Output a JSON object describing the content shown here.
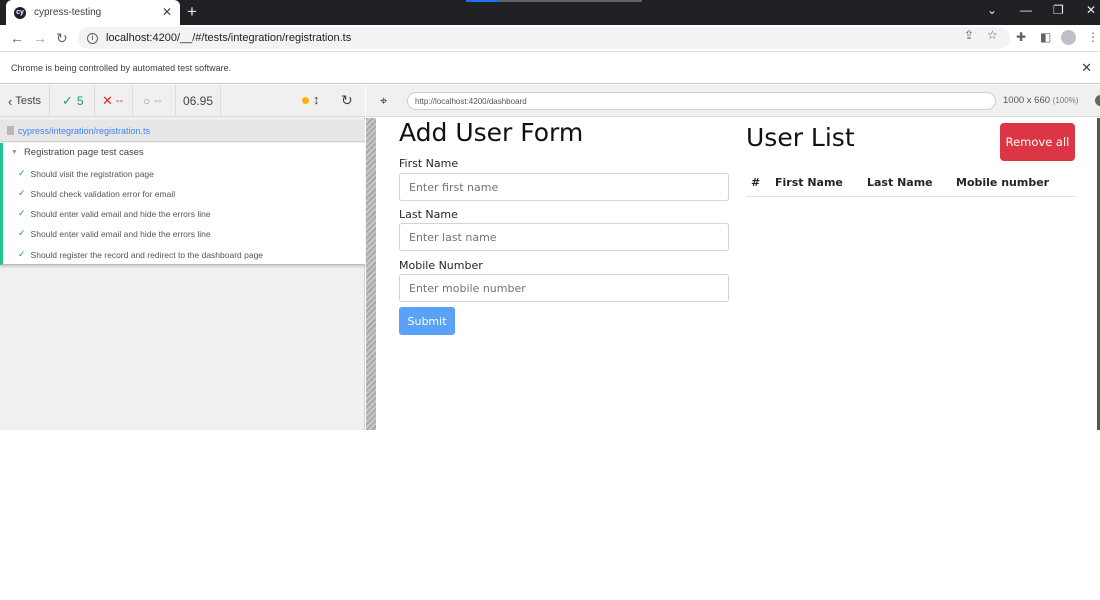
{
  "browser": {
    "tab_title": "cypress-testing",
    "favicon_text": "cy",
    "address": "localhost:4200/__/#/tests/integration/registration.ts",
    "infobar_message": "Chrome is being controlled by automated test software."
  },
  "reporter": {
    "back_label": "Tests",
    "passed": "5",
    "failed": "--",
    "pending": "--",
    "duration": "06.95",
    "spec_path": "cypress/integration/registration.ts",
    "suite_title": "Registration page test cases",
    "tests": [
      "Should visit the registration page",
      "Should check validation error for email",
      "Should enter valid email and hide the errors line",
      "Should enter valid email and hide the errors line",
      "Should register the record and redirect to the dashboard page"
    ]
  },
  "aut": {
    "url": "http://localhost:4200/dashboard",
    "viewport": "1000 x 660",
    "scale": "(100%)"
  },
  "app": {
    "form_title": "Add User Form",
    "first_name_label": "First Name",
    "first_name_placeholder": "Enter first name",
    "last_name_label": "Last Name",
    "last_name_placeholder": "Enter last name",
    "mobile_label": "Mobile Number",
    "mobile_placeholder": "Enter mobile number",
    "submit_label": "Submit",
    "list_title": "User List",
    "remove_all_label": "Remove all",
    "table_headers": [
      "#",
      "First Name",
      "Last Name",
      "Mobile number"
    ]
  },
  "colors": {
    "pass": "#19a05a",
    "fail": "#e0311f",
    "link": "#3f82f5",
    "danger": "#dc3545",
    "primary_disabled": "#5aa2f8"
  }
}
